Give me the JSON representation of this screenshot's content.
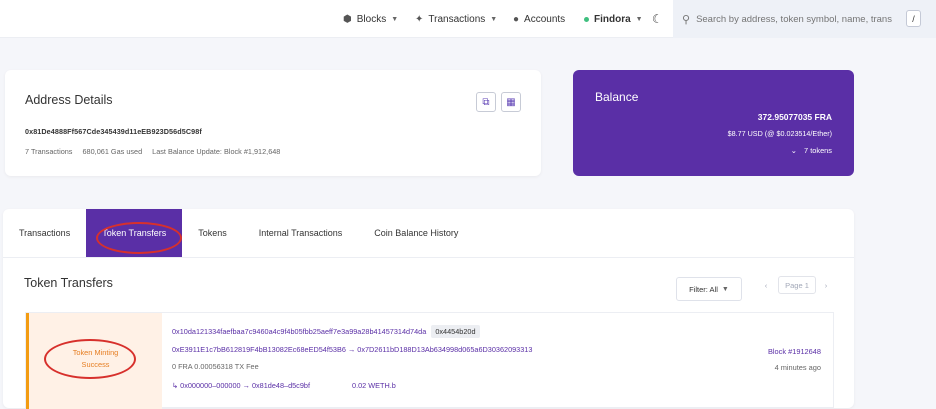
{
  "nav": {
    "blocks": "Blocks",
    "transactions": "Transactions",
    "accounts": "Accounts",
    "network": "Findora",
    "search_placeholder": "Search by address, token symbol, name, transacti",
    "search_shortcut": "/"
  },
  "address": {
    "title": "Address Details",
    "hash": "0x81De4888Ff567Cde345439d11eEB923D56d5C98f",
    "tx_count": "7 Transactions",
    "gas_used": "680,061 Gas used",
    "last_update": "Last Balance Update: Block #1,912,648"
  },
  "balance": {
    "title": "Balance",
    "amount": "372.95077035 FRA",
    "usd": "$8.77 USD (@ $0.023514/Ether)",
    "tokens": "7 tokens"
  },
  "tabs": [
    "Transactions",
    "Token Transfers",
    "Tokens",
    "Internal Transactions",
    "Coin Balance History"
  ],
  "token_transfers": {
    "title": "Token Transfers",
    "filter": "Filter: All",
    "page": "Page 1"
  },
  "transfer": {
    "type": "Token Minting",
    "status": "Success",
    "tx_hash": "0x10da121334faefbaa7c9460a4c9f4b05fbb25aeff7e3a99a28b41457314d74da",
    "method": "0x4454b20d",
    "from_to": "0xE3911E1c7bB612819F4bB13082Ec68eED54f53B6 → 0x7D2611bD188D13Ab634998d065a6D30362093313",
    "fee": "0 FRA 0.00056318 TX Fee",
    "token_path": "↳ 0x000000–000000 → 0x81de48–d5c9bf",
    "token_amount": "0.02 WETH.b",
    "block": "Block #1912648",
    "age": "4 minutes ago"
  },
  "colors": {
    "accent": "#5a2fa6",
    "highlight_ring": "#d7302c",
    "minting": "#e67e22"
  }
}
